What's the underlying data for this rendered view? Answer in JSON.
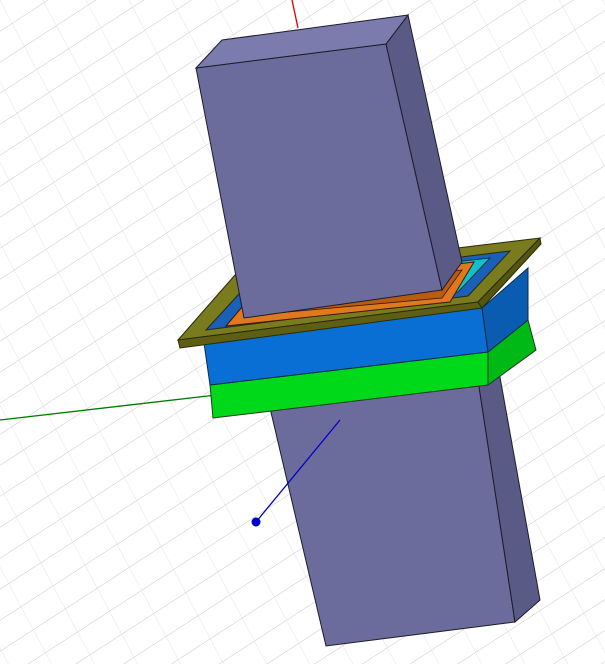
{
  "scene": {
    "kind": "3d-model-viewport",
    "background": "#ffffff",
    "grid_color": "#c8c8c8",
    "axes": {
      "x_color": "#007a00",
      "y_color": "#d40000",
      "z_color": "#0000cc"
    },
    "objects": [
      {
        "name": "vertical-bar",
        "color": "#6c6c9c"
      },
      {
        "name": "olive-frame",
        "color": "#7a7a1e"
      },
      {
        "name": "blue-layer",
        "color": "#0a6fd4"
      },
      {
        "name": "green-layer",
        "color": "#00d91a"
      },
      {
        "name": "orange-winding",
        "color": "#e07820"
      },
      {
        "name": "cyan-insulator",
        "color": "#12c0c8"
      }
    ]
  }
}
